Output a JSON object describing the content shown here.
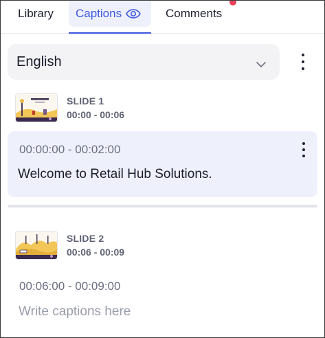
{
  "tabs": [
    {
      "label": "Library"
    },
    {
      "label": "Captions",
      "icon": "eye-icon",
      "active": true
    },
    {
      "label": "Comments",
      "has_notification": true
    }
  ],
  "language": {
    "selected": "English",
    "icon": "chevron-down-icon"
  },
  "slides": [
    {
      "label": "SLIDE 1",
      "range": "00:00 - 00:06",
      "thumbnail_title": "Retail Solutions Hub",
      "caption": {
        "time": "00:00:00 - 00:02:00",
        "text": "Welcome to Retail Hub Solutions."
      }
    },
    {
      "label": "SLIDE 2",
      "range": "00:06 - 00:09",
      "caption": {
        "time": "00:06:00 - 00:09:00",
        "text": "",
        "placeholder": "Write captions here"
      }
    }
  ],
  "colors": {
    "accent": "#3d56e0",
    "active_bg": "#eef1fc",
    "notification": "#e8435a"
  }
}
